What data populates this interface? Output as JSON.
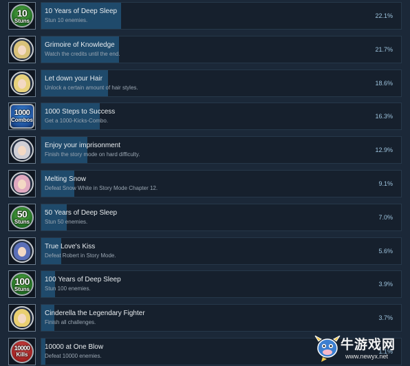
{
  "achievements": [
    {
      "title": "10 Years of Deep Sleep",
      "description": "Stun 10 enemies.",
      "percent_label": "22.1%",
      "percent": 22.1,
      "icon": "stuns-10-icon",
      "icon_kind": "badge",
      "badge_number": "10",
      "badge_word": "Stuns",
      "badge_color": "green"
    },
    {
      "title": "Grimoire of Knowledge",
      "description": "Watch the credits until the end.",
      "percent_label": "21.7%",
      "percent": 21.7,
      "icon": "grimoire-portrait-icon",
      "icon_kind": "portrait",
      "hair_color": "#d9c27a"
    },
    {
      "title": "Let down your Hair",
      "description": "Unlock a certain amount of hair styles.",
      "percent_label": "18.6%",
      "percent": 18.6,
      "icon": "rapunzel-portrait-icon",
      "icon_kind": "portrait",
      "hair_color": "#e8d27c"
    },
    {
      "title": "1000 Steps to Success",
      "description": "Get a 1000-Kicks-Combo.",
      "percent_label": "16.3%",
      "percent": 16.3,
      "icon": "combos-1000-icon",
      "icon_kind": "badge",
      "badge_number": "1000",
      "badge_word": "Combos",
      "badge_color": "blue"
    },
    {
      "title": "Enjoy your imprisonment",
      "description": "Finish the story mode on hard difficulty.",
      "percent_label": "12.9%",
      "percent": 12.9,
      "icon": "prisoner-portrait-icon",
      "icon_kind": "portrait",
      "hair_color": "#cfcfd6"
    },
    {
      "title": "Melting Snow",
      "description": "Defeat Snow White in Story Mode Chapter 12.",
      "percent_label": "9.1%",
      "percent": 9.1,
      "icon": "snow-white-portrait-icon",
      "icon_kind": "portrait",
      "hair_color": "#e0a9c0"
    },
    {
      "title": "50 Years of Deep Sleep",
      "description": "Stun 50 enemies.",
      "percent_label": "7.0%",
      "percent": 7.0,
      "icon": "stuns-50-icon",
      "icon_kind": "badge",
      "badge_number": "50",
      "badge_word": "Stuns",
      "badge_color": "green"
    },
    {
      "title": "True Love's Kiss",
      "description": "Defeat Robert in Story Mode.",
      "percent_label": "5.6%",
      "percent": 5.6,
      "icon": "robert-portrait-icon",
      "icon_kind": "portrait",
      "hair_color": "#5a6fb8"
    },
    {
      "title": "100 Years of Deep Sleep",
      "description": "Stun 100 enemies.",
      "percent_label": "3.9%",
      "percent": 3.9,
      "icon": "stuns-100-icon",
      "icon_kind": "badge",
      "badge_number": "100",
      "badge_word": "Stuns",
      "badge_color": "green"
    },
    {
      "title": "Cinderella the Legendary Fighter",
      "description": "Finish all challenges.",
      "percent_label": "3.7%",
      "percent": 3.7,
      "icon": "cinderella-portrait-icon",
      "icon_kind": "portrait",
      "hair_color": "#e9cf72"
    },
    {
      "title": "10000 at One Blow",
      "description": "Defeat 10000 enemies.",
      "percent_label": "1.1%",
      "percent": 1.1,
      "icon": "kills-10000-icon",
      "icon_kind": "badge",
      "badge_number": "10000",
      "badge_word": "Kills",
      "badge_color": "red"
    }
  ],
  "watermark": {
    "text": "牛游戏网",
    "url": "www.newyx.net",
    "icon": "cow-mascot-logo-icon"
  },
  "colors": {
    "background": "#1b2838",
    "bar_fill": "#1f4a6b",
    "percent_text": "#9ec4de"
  }
}
